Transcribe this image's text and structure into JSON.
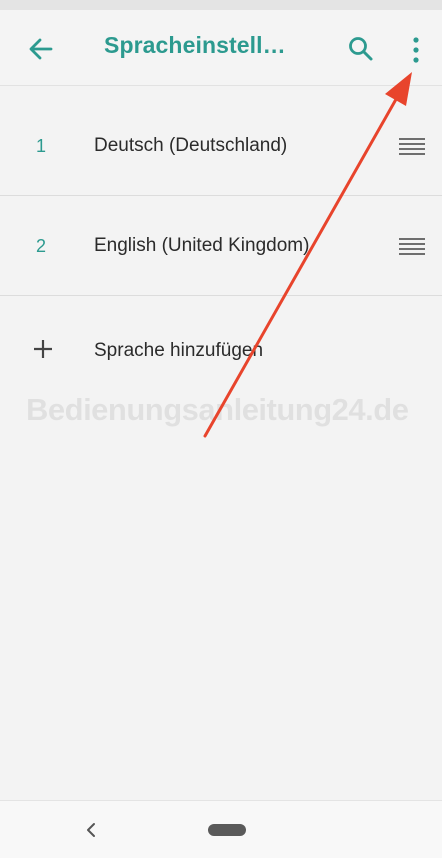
{
  "app_bar": {
    "title": "Spracheinstell…",
    "back_icon": "arrow-left-icon",
    "search_icon": "search-icon",
    "menu_icon": "more-vertical-icon",
    "accent_color": "#2c9a8f"
  },
  "languages": [
    {
      "index": "1",
      "name": "Deutsch (Deutschland)",
      "handle_icon": "drag-handle-icon"
    },
    {
      "index": "2",
      "name": "English (United Kingdom)",
      "handle_icon": "drag-handle-icon"
    }
  ],
  "add_language": {
    "label": "Sprache hinzufügen",
    "icon": "plus-icon"
  },
  "watermark": {
    "text": "Bedienungsanleitung24.de"
  },
  "annotation": {
    "arrow_color": "#e8442c",
    "arrow_icon": "red-arrow-annotation"
  },
  "nav_bar": {
    "back_icon": "nav-back-icon",
    "home_icon": "nav-home-pill-icon"
  }
}
